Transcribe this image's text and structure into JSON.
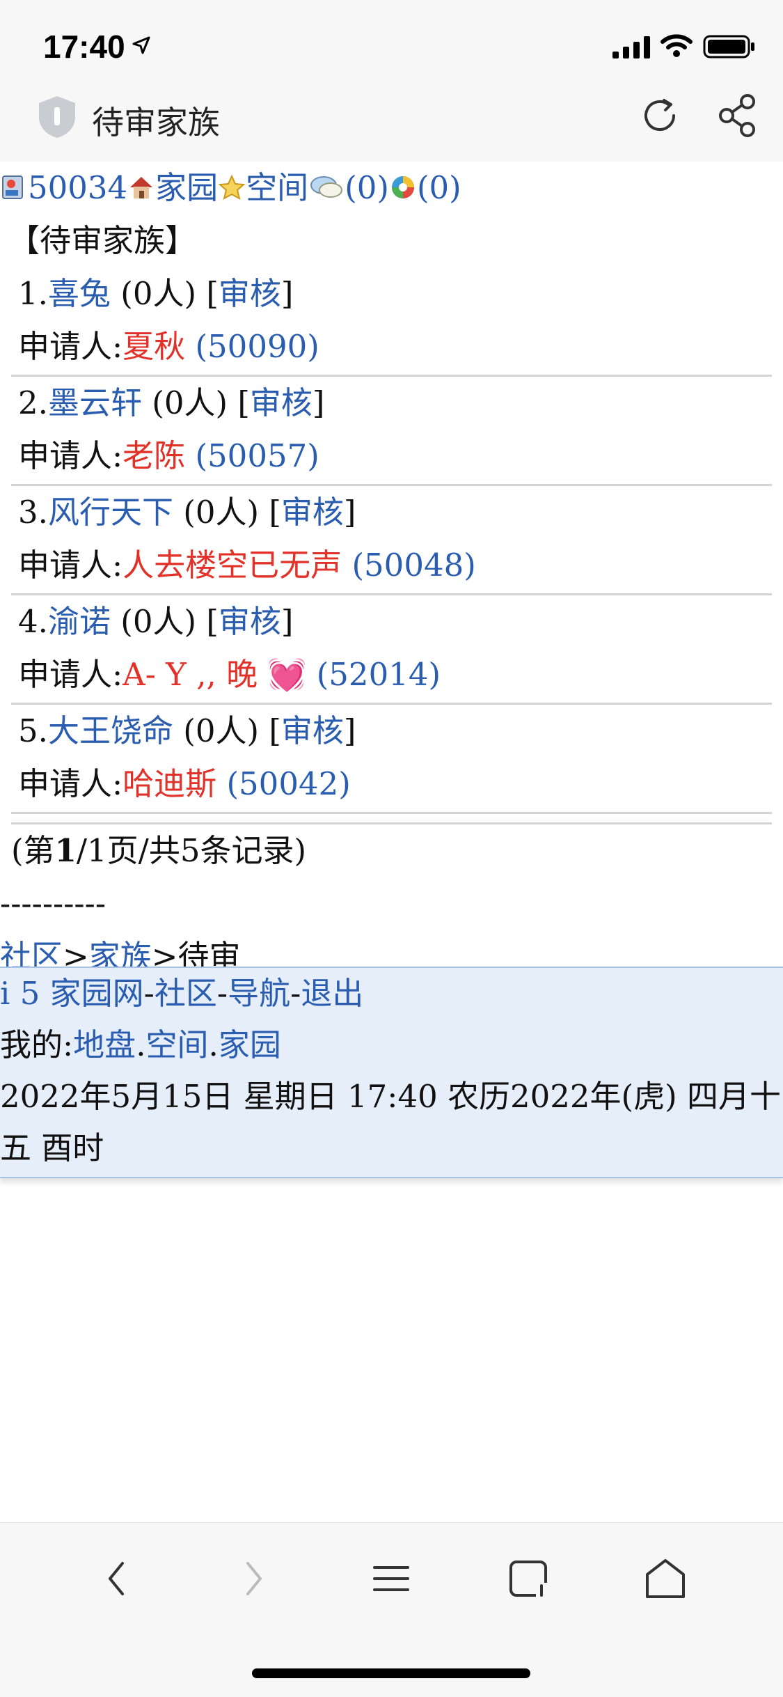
{
  "status": {
    "time": "17:40"
  },
  "header": {
    "title": "待审家族"
  },
  "topline": {
    "user_id": "50034",
    "home": "家园",
    "space": "空间",
    "msg_count": "(0)",
    "other_count": "(0)"
  },
  "section_title": "【待审家族】",
  "families": [
    {
      "index": "1.",
      "name": "喜兔",
      "members": "(0人)",
      "review_label": "审核",
      "applicant_label": "申请人:",
      "applicant": "夏秋",
      "applicant_id": "(50090)"
    },
    {
      "index": "2.",
      "name": "墨云轩",
      "members": "(0人)",
      "review_label": "审核",
      "applicant_label": "申请人:",
      "applicant": "老陈",
      "applicant_id": "(50057)"
    },
    {
      "index": "3.",
      "name": "风行天下",
      "members": "(0人)",
      "review_label": "审核",
      "applicant_label": "申请人:",
      "applicant": "人去楼空已无声",
      "applicant_id": "(50048)"
    },
    {
      "index": "4.",
      "name": "渝诺",
      "members": "(0人)",
      "review_label": "审核",
      "applicant_label": "申请人:",
      "applicant": "A- Y ,, 晚 💓",
      "applicant_id": "(52014)"
    },
    {
      "index": "5.",
      "name": "大王饶命",
      "members": "(0人)",
      "review_label": "审核",
      "applicant_label": "申请人:",
      "applicant": "哈迪斯",
      "applicant_id": "(50042)"
    }
  ],
  "pager": {
    "prefix": "(第",
    "current": "1",
    "suffix": "/1页/共5条记录)"
  },
  "dashes": "----------",
  "breadcrumb": {
    "community": "社区",
    "family": "家族",
    "current": "待审",
    "sep": ">"
  },
  "footer": {
    "site": "i 5 家园网",
    "community": "社区",
    "nav": "导航",
    "logout": "退出",
    "dash": "-",
    "mine_label": "我的:",
    "turf": "地盘",
    "space": "空间",
    "home": "家园",
    "dot": ".",
    "datetime": "2022年5月15日  星期日  17:40  农历2022年(虎) 四月十五  酉时"
  }
}
